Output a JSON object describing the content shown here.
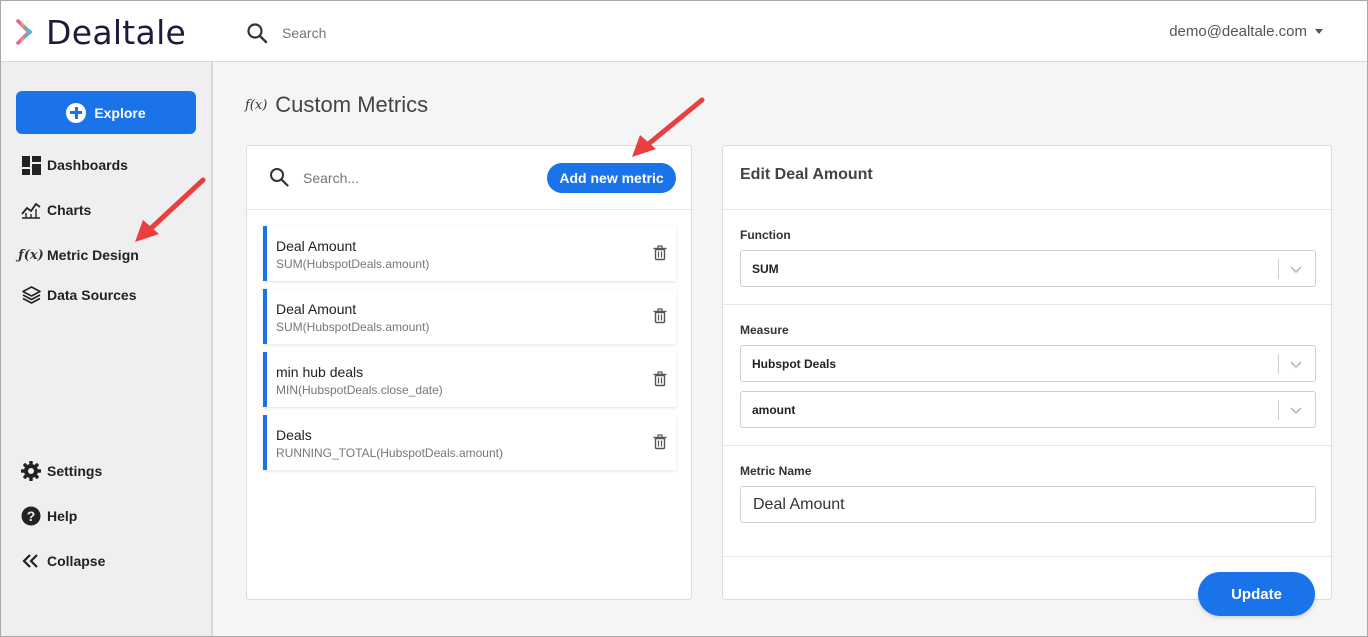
{
  "brand": {
    "name": "Dealtale"
  },
  "header": {
    "search_placeholder": "Search",
    "user_email": "demo@dealtale.com"
  },
  "sidebar": {
    "explore_label": "Explore",
    "items": [
      {
        "label": "Dashboards",
        "icon": "dashboard-icon"
      },
      {
        "label": "Charts",
        "icon": "chart-icon"
      },
      {
        "label": "Metric Design",
        "icon": "function-icon"
      },
      {
        "label": "Data Sources",
        "icon": "layers-icon"
      }
    ],
    "bottom_items": [
      {
        "label": "Settings",
        "icon": "gear-icon"
      },
      {
        "label": "Help",
        "icon": "help-icon"
      },
      {
        "label": "Collapse",
        "icon": "collapse-icon"
      }
    ]
  },
  "page": {
    "title_icon": "f(x)",
    "title": "Custom Metrics"
  },
  "metrics_list": {
    "search_placeholder": "Search...",
    "add_button_label": "Add new metric",
    "items": [
      {
        "name": "Deal Amount",
        "formula": "SUM(HubspotDeals.amount)"
      },
      {
        "name": "Deal Amount",
        "formula": "SUM(HubspotDeals.amount)"
      },
      {
        "name": "min hub deals",
        "formula": "MIN(HubspotDeals.close_date)"
      },
      {
        "name": "Deals",
        "formula": "RUNNING_TOTAL(HubspotDeals.amount)"
      }
    ]
  },
  "edit_panel": {
    "title": "Edit Deal Amount",
    "function_label": "Function",
    "function_value": "SUM",
    "measure_label": "Measure",
    "measure_source_value": "Hubspot Deals",
    "measure_field_value": "amount",
    "metric_name_label": "Metric Name",
    "metric_name_value": "Deal Amount",
    "update_button_label": "Update"
  },
  "colors": {
    "accent": "#1a73e8",
    "annotation_arrow": "#e84040"
  }
}
